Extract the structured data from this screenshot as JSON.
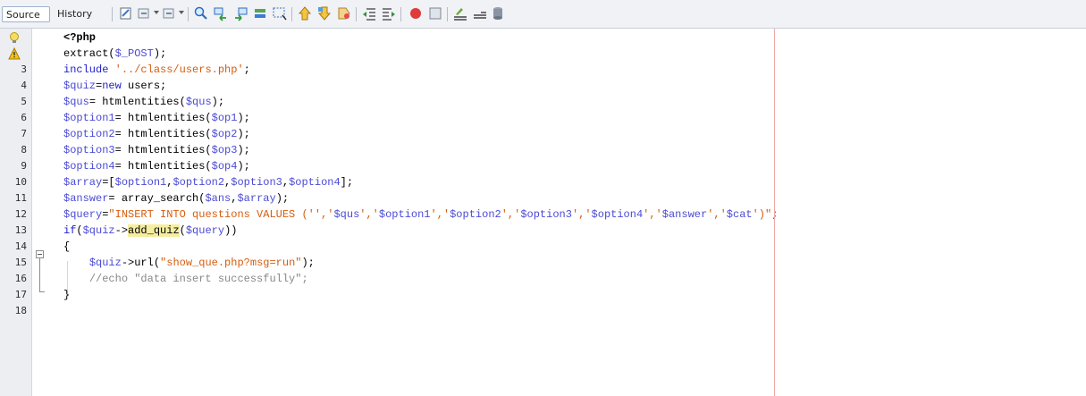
{
  "tabs": [
    {
      "label": "Source",
      "active": true
    },
    {
      "label": "History",
      "active": false
    }
  ],
  "toolbar_icons": [
    "last-edit-icon",
    "back-icon",
    "forward-icon",
    "find-selection-icon",
    "find-previous-icon",
    "find-next-icon",
    "toggle-highlight-icon",
    "toggle-rect-selection-icon",
    "previous-bookmark-icon",
    "next-bookmark-icon",
    "toggle-bookmark-icon",
    "shift-left-icon",
    "shift-right-icon",
    "start-macro-icon",
    "stop-macro-icon",
    "comment-icon",
    "uncomment-icon",
    "database-icon"
  ],
  "gutter": {
    "line_numbers": [
      "",
      "",
      "3",
      "4",
      "5",
      "6",
      "7",
      "8",
      "9",
      "10",
      "11",
      "12",
      "13",
      "14",
      "15",
      "16",
      "17",
      "18"
    ],
    "line1_icon": "hint-bulb-icon",
    "line2_icon": "warning-icon"
  },
  "code_lines": [
    [
      {
        "t": "<?php",
        "c": "php"
      }
    ],
    [
      {
        "t": "extract(",
        "c": ""
      },
      {
        "t": "$_POST",
        "c": "var"
      },
      {
        "t": ");",
        "c": ""
      }
    ],
    [
      {
        "t": "include",
        "c": "kw"
      },
      {
        "t": " ",
        "c": ""
      },
      {
        "t": "'../class/users.php'",
        "c": "str"
      },
      {
        "t": ";",
        "c": ""
      }
    ],
    [
      {
        "t": "$quiz",
        "c": "var"
      },
      {
        "t": "=",
        "c": ""
      },
      {
        "t": "new",
        "c": "kw"
      },
      {
        "t": " users;",
        "c": ""
      }
    ],
    [
      {
        "t": "$qus",
        "c": "var"
      },
      {
        "t": "= htmlentities(",
        "c": ""
      },
      {
        "t": "$qus",
        "c": "var"
      },
      {
        "t": ");",
        "c": ""
      }
    ],
    [
      {
        "t": "$option1",
        "c": "var"
      },
      {
        "t": "= htmlentities(",
        "c": ""
      },
      {
        "t": "$op1",
        "c": "var"
      },
      {
        "t": ");",
        "c": ""
      }
    ],
    [
      {
        "t": "$option2",
        "c": "var"
      },
      {
        "t": "= htmlentities(",
        "c": ""
      },
      {
        "t": "$op2",
        "c": "var"
      },
      {
        "t": ");",
        "c": ""
      }
    ],
    [
      {
        "t": "$option3",
        "c": "var"
      },
      {
        "t": "= htmlentities(",
        "c": ""
      },
      {
        "t": "$op3",
        "c": "var"
      },
      {
        "t": ");",
        "c": ""
      }
    ],
    [
      {
        "t": "$option4",
        "c": "var"
      },
      {
        "t": "= htmlentities(",
        "c": ""
      },
      {
        "t": "$op4",
        "c": "var"
      },
      {
        "t": ");",
        "c": ""
      }
    ],
    [
      {
        "t": "$array",
        "c": "var"
      },
      {
        "t": "=[",
        "c": ""
      },
      {
        "t": "$option1",
        "c": "var"
      },
      {
        "t": ",",
        "c": ""
      },
      {
        "t": "$option2",
        "c": "var"
      },
      {
        "t": ",",
        "c": ""
      },
      {
        "t": "$option3",
        "c": "var"
      },
      {
        "t": ",",
        "c": ""
      },
      {
        "t": "$option4",
        "c": "var"
      },
      {
        "t": "];",
        "c": ""
      }
    ],
    [
      {
        "t": "$answer",
        "c": "var"
      },
      {
        "t": "= array_search(",
        "c": ""
      },
      {
        "t": "$ans",
        "c": "var"
      },
      {
        "t": ",",
        "c": ""
      },
      {
        "t": "$array",
        "c": "var"
      },
      {
        "t": ");",
        "c": ""
      }
    ],
    [
      {
        "t": "$query",
        "c": "var"
      },
      {
        "t": "=",
        "c": ""
      },
      {
        "t": "\"INSERT INTO questions VALUES ('','",
        "c": "str"
      },
      {
        "t": "$qus",
        "c": "var"
      },
      {
        "t": "','",
        "c": "str"
      },
      {
        "t": "$option1",
        "c": "var"
      },
      {
        "t": "','",
        "c": "str"
      },
      {
        "t": "$option2",
        "c": "var"
      },
      {
        "t": "','",
        "c": "str"
      },
      {
        "t": "$option3",
        "c": "var"
      },
      {
        "t": "','",
        "c": "str"
      },
      {
        "t": "$option4",
        "c": "var"
      },
      {
        "t": "','",
        "c": "str"
      },
      {
        "t": "$answer",
        "c": "var"
      },
      {
        "t": "','",
        "c": "str"
      },
      {
        "t": "$cat",
        "c": "var"
      },
      {
        "t": "')\"",
        "c": "str"
      },
      {
        "t": ";",
        "c": ""
      }
    ],
    [
      {
        "t": "if",
        "c": "kw"
      },
      {
        "t": "(",
        "c": ""
      },
      {
        "t": "$quiz",
        "c": "var"
      },
      {
        "t": "->",
        "c": ""
      },
      {
        "t": "add_quiz",
        "c": "hl"
      },
      {
        "t": "(",
        "c": ""
      },
      {
        "t": "$query",
        "c": "var"
      },
      {
        "t": "))",
        "c": ""
      }
    ],
    [
      {
        "t": "{",
        "c": ""
      }
    ],
    [
      {
        "t": "    ",
        "c": ""
      },
      {
        "t": "$quiz",
        "c": "var"
      },
      {
        "t": "->url(",
        "c": ""
      },
      {
        "t": "\"show_que.php?msg=run\"",
        "c": "str"
      },
      {
        "t": ");",
        "c": ""
      }
    ],
    [
      {
        "t": "    ",
        "c": ""
      },
      {
        "t": "//echo \"data insert successfully\";",
        "c": "cmt"
      }
    ],
    [
      {
        "t": "}",
        "c": ""
      }
    ],
    [
      {
        "t": "",
        "c": ""
      }
    ]
  ]
}
